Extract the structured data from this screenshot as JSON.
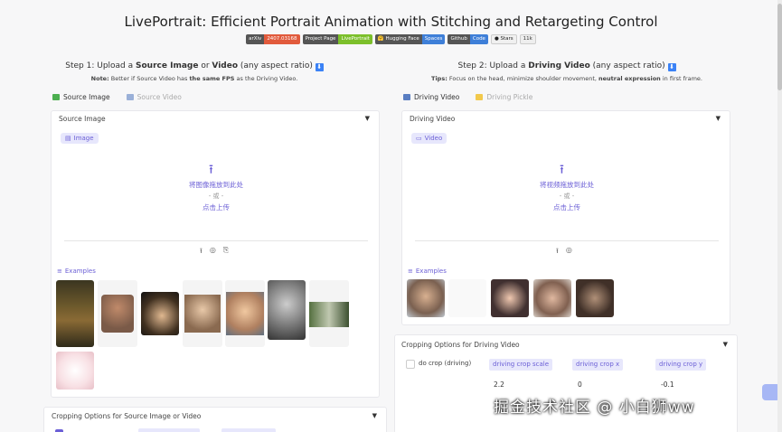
{
  "title": "LivePortrait: Efficient Portrait Animation with Stitching and Retargeting Control",
  "badges": [
    {
      "left": "arXiv",
      "right": "2407.03168",
      "color": "#e15a3c"
    },
    {
      "left": "Project Page",
      "right": "LivePortrait",
      "color": "#7cbf2b"
    },
    {
      "left": "🤗 Hugging Face",
      "right": "Spaces",
      "color": "#3e7fd8"
    },
    {
      "left": "Github",
      "right": "Code",
      "color": "#3e7fd8"
    }
  ],
  "stars": {
    "label": "Stars",
    "count": "11k"
  },
  "step1": {
    "prefix": "Step 1: Upload a ",
    "b1": "Source Image",
    "mid": " or ",
    "b2": "Video",
    "suffix": " (any aspect ratio)",
    "icon": "⬇",
    "note_prefix": "Note:",
    "note_text": " Better if Source Video has ",
    "note_bold": "the same FPS",
    "note_suffix": " as the Driving Video."
  },
  "step2": {
    "prefix": "Step 2: Upload a ",
    "b1": "Driving Video",
    "suffix": " (any aspect ratio)",
    "icon": "⬇",
    "tip_prefix": "Tips:",
    "tip_text": " Focus on the head, minimize shoulder movement, ",
    "tip_bold": "neutral expression",
    "tip_suffix": " in first frame."
  },
  "left_tabs": [
    "Source Image",
    "Source Video"
  ],
  "right_tabs": [
    "Driving Video",
    "Driving Pickle"
  ],
  "source_panel": {
    "label": "Source Image",
    "chip": "Image",
    "drop": "将图像拖放到此处",
    "or": "- 或 -",
    "click": "点击上传",
    "examples": "Examples"
  },
  "driving_panel": {
    "label": "Driving Video",
    "chip": "Video",
    "drop": "将视频拖放到此处",
    "or": "- 或 -",
    "click": "点击上传",
    "examples": "Examples"
  },
  "crop_driving": {
    "title": "Cropping Options for Driving Video",
    "checkbox": "do crop (driving)",
    "fields": [
      {
        "label": "driving crop scale",
        "value": "2.2"
      },
      {
        "label": "driving crop x",
        "value": "0"
      },
      {
        "label": "driving crop y",
        "value": "-0.1"
      }
    ]
  },
  "crop_source": {
    "title": "Cropping Options for Source Image or Video"
  },
  "watermark": "掘金技术社区 @ 小白狮ww"
}
